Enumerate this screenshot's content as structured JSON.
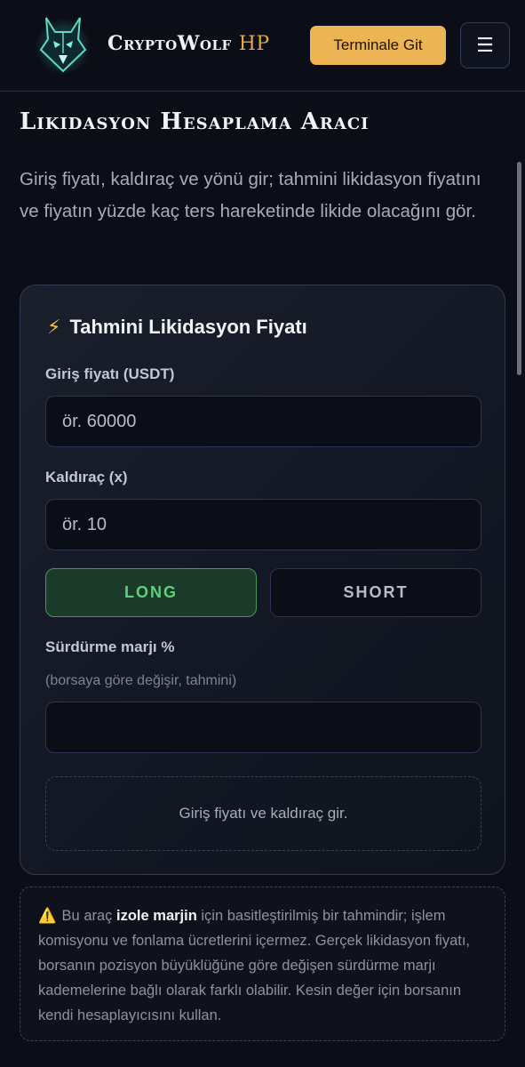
{
  "header": {
    "brand": "CryptoWolf",
    "brand_suffix": "HP",
    "terminal_button": "Terminale Git",
    "menu_icon": "hamburger-icon"
  },
  "page": {
    "title": "Likidasyon Hesaplama Aracı",
    "intro": "Giriş fiyatı, kaldıraç ve yönü gir; tahmini likidasyon fiyatını ve fiyatın yüzde kaç ters hareketinde likide olacağını gör."
  },
  "calculator": {
    "title": "Tahmini Likidasyon Fiyatı",
    "title_icon": "lightning-icon",
    "entry_label": "Giriş fiyatı (USDT)",
    "entry_placeholder": "ör. 60000",
    "entry_value": "",
    "leverage_label": "Kaldıraç (x)",
    "leverage_placeholder": "ör. 10",
    "leverage_value": "",
    "long_label": "LONG",
    "short_label": "SHORT",
    "selected_side": "LONG",
    "margin_label": "Sürdürme marjı %",
    "margin_hint": "(borsaya göre değişir, tahmini)",
    "margin_value": "",
    "result_text": "Giriş fiyatı ve kaldıraç gir."
  },
  "disclaimer": {
    "icon": "warning-icon",
    "prefix": "Bu araç",
    "highlight": "izole marjin",
    "text": "için basitleştirilmiş bir tahmindir; işlem komisyonu ve fonlama ücretlerini içermez. Gerçek likidasyon fiyatı, borsanın pozisyon büyüklüğüne göre değişen sürdürme marjı kademelerine bağlı olarak farklı olabilir. Kesin değer için borsanın kendi hesaplayıcısını kullan."
  },
  "colors": {
    "background": "#0b0e16",
    "accent": "#ecb452",
    "long_green": "#5fd07d"
  }
}
